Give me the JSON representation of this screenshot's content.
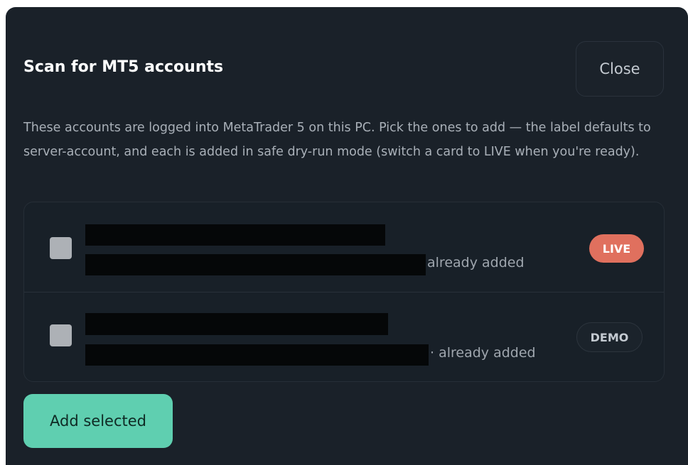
{
  "dialog": {
    "title": "Scan for MT5 accounts",
    "close_label": "Close",
    "description": "These accounts are logged into MetaTrader 5 on this PC. Pick the ones to add — the label defaults to server-account, and each is added in safe dry-run mode (switch a card to LIVE when you're ready)."
  },
  "accounts": [
    {
      "checked": false,
      "status": "already added",
      "badge": "LIVE",
      "badge_color": "#e0705e"
    },
    {
      "checked": false,
      "status": "· already added",
      "badge": "DEMO",
      "badge_color": "#1b232b"
    }
  ],
  "footer": {
    "add_label": "Add selected",
    "add_color": "#5fcfb0"
  },
  "colors": {
    "background": "#1a2129",
    "text_primary": "#ffffff",
    "text_secondary": "#a9b0b8"
  }
}
